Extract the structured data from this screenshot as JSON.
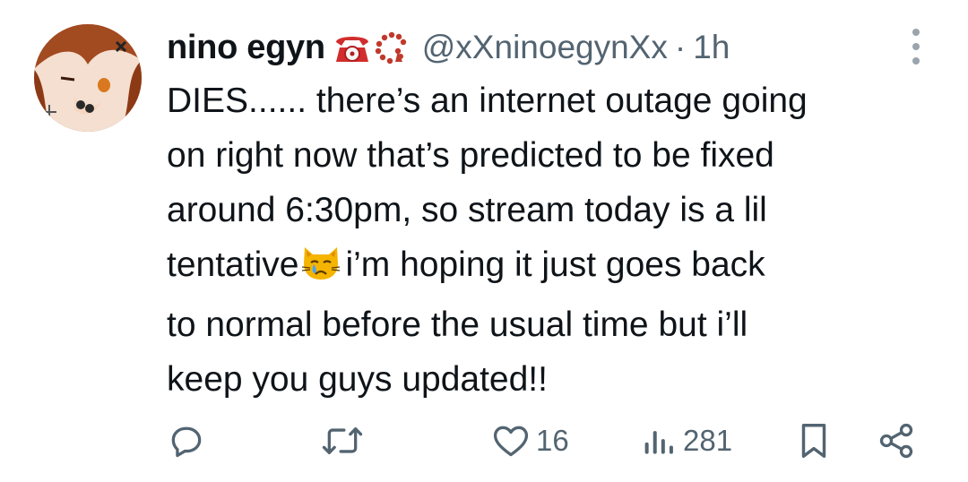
{
  "author": {
    "display_name": "nino egyn",
    "name_emojis": [
      "telephone-emoji",
      "prayer-beads-emoji"
    ],
    "handle": "@xXninoegynXx",
    "separator": "·",
    "time_ago": "1h"
  },
  "tweet": {
    "lines": [
      "DIES...... there’s an internet outage going",
      "on right now that’s predicted to be fixed",
      "around 6:30pm, so stream today is a lil",
      "i’m hoping it just goes back",
      "to normal before the usual time but i’ll",
      "keep you guys updated!!"
    ],
    "line4_prefix": "tentative",
    "inline_emoji": "crying-cat-emoji"
  },
  "actions": {
    "reply_icon": "reply-icon",
    "retweet_icon": "retweet-icon",
    "like_icon": "heart-icon",
    "like_count": "16",
    "views_icon": "views-icon",
    "view_count": "281",
    "bookmark_icon": "bookmark-icon",
    "share_icon": "share-icon"
  },
  "colors": {
    "text": "#0f1419",
    "secondary": "#536471",
    "background": "#ffffff"
  }
}
